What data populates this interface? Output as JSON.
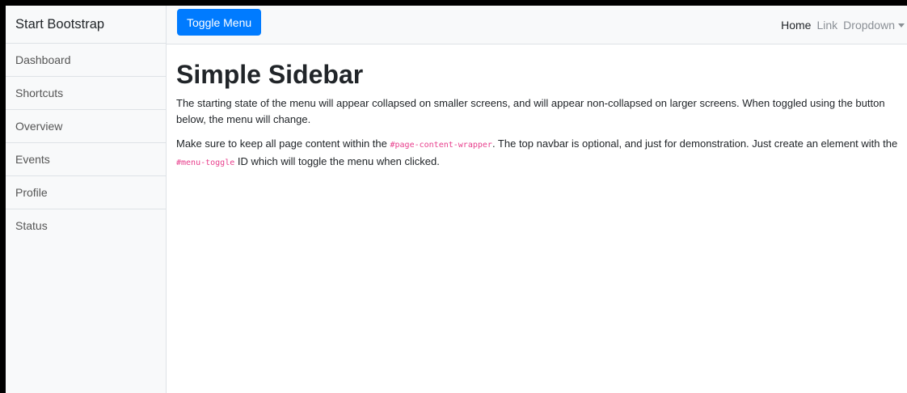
{
  "sidebar": {
    "heading": "Start Bootstrap",
    "items": [
      {
        "label": "Dashboard"
      },
      {
        "label": "Shortcuts"
      },
      {
        "label": "Overview"
      },
      {
        "label": "Events"
      },
      {
        "label": "Profile"
      },
      {
        "label": "Status"
      }
    ]
  },
  "navbar": {
    "toggle_label": "Toggle Menu",
    "links": {
      "home": "Home",
      "link": "Link",
      "dropdown": "Dropdown"
    }
  },
  "main": {
    "title": "Simple Sidebar",
    "para1": "The starting state of the menu will appear collapsed on smaller screens, and will appear non-collapsed on larger screens. When toggled using the button below, the menu will change.",
    "para2": {
      "before": "Make sure to keep all page content within the ",
      "code1": "#page-content-wrapper",
      "middle": ". The top navbar is optional, and just for demonstration. Just create an element with the ",
      "code2": "#menu-toggle",
      "after": " ID which will toggle the menu when clicked."
    }
  },
  "colors": {
    "primary": "#007bff",
    "code": "#e83e8c",
    "sidebar_bg": "#f8f9fa",
    "border": "#dee2e6"
  }
}
